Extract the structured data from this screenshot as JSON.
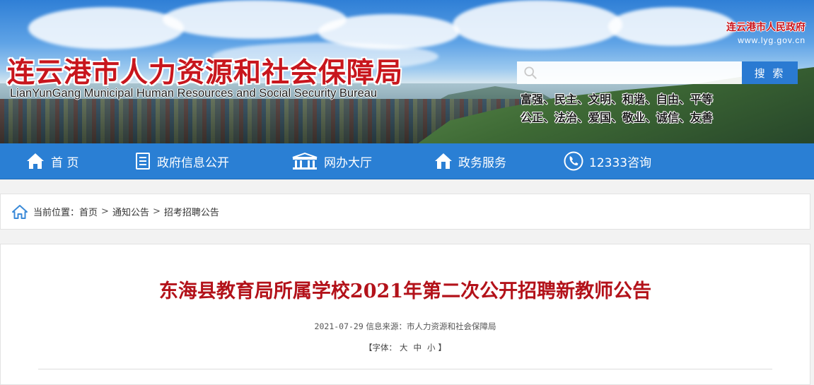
{
  "header": {
    "title": "连云港市人力资源和社会保障局",
    "subtitle": "LianYunGang Municipal Human Resources and Social Security Bureau",
    "gov_name": "连云港市人民政府",
    "gov_url": "www.lyg.gov.cn",
    "search": {
      "placeholder": "",
      "value": "",
      "button_label": "搜 索"
    },
    "values_line1": "富强、民主、文明、和谐、自由、平等",
    "values_line2": "公正、法治、爱国、敬业、诚信、友善"
  },
  "nav": {
    "items": [
      {
        "label": "首 页",
        "icon": "home-icon"
      },
      {
        "label": "政府信息公开",
        "icon": "document-icon"
      },
      {
        "label": "网办大厅",
        "icon": "building-icon"
      },
      {
        "label": "政务服务",
        "icon": "house-service-icon"
      },
      {
        "label": "12333咨询",
        "icon": "phone-icon"
      }
    ]
  },
  "breadcrumb": {
    "prefix": "当前位置：",
    "items": [
      "首页",
      "通知公告",
      "招考招聘公告"
    ],
    "separator": ">"
  },
  "article": {
    "title": "东海县教育局所属学校2021年第二次公开招聘新教师公告",
    "date": "2021-07-29",
    "source_label": "信息来源：",
    "source": "市人力资源和社会保障局",
    "font_label_open": "【字体：",
    "font_large": "大",
    "font_medium": "中",
    "font_small": "小",
    "font_label_close": "】"
  },
  "colors": {
    "brand_red": "#c8161d",
    "nav_blue": "#2a7fd4",
    "title_red": "#b3121a"
  }
}
